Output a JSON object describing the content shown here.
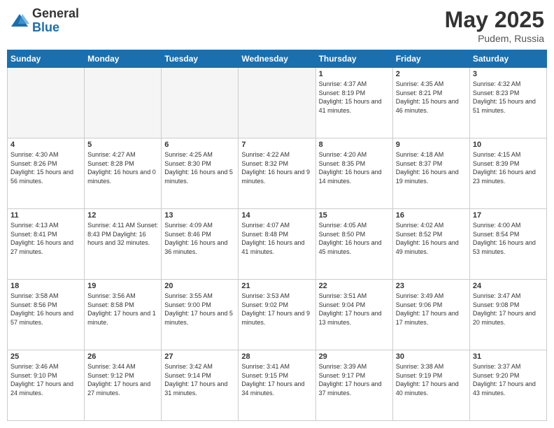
{
  "header": {
    "logo_general": "General",
    "logo_blue": "Blue",
    "title": "May 2025",
    "location": "Pudem, Russia"
  },
  "weekdays": [
    "Sunday",
    "Monday",
    "Tuesday",
    "Wednesday",
    "Thursday",
    "Friday",
    "Saturday"
  ],
  "weeks": [
    [
      {
        "day": "",
        "info": ""
      },
      {
        "day": "",
        "info": ""
      },
      {
        "day": "",
        "info": ""
      },
      {
        "day": "",
        "info": ""
      },
      {
        "day": "1",
        "info": "Sunrise: 4:37 AM\nSunset: 8:19 PM\nDaylight: 15 hours\nand 41 minutes."
      },
      {
        "day": "2",
        "info": "Sunrise: 4:35 AM\nSunset: 8:21 PM\nDaylight: 15 hours\nand 46 minutes."
      },
      {
        "day": "3",
        "info": "Sunrise: 4:32 AM\nSunset: 8:23 PM\nDaylight: 15 hours\nand 51 minutes."
      }
    ],
    [
      {
        "day": "4",
        "info": "Sunrise: 4:30 AM\nSunset: 8:26 PM\nDaylight: 15 hours\nand 56 minutes."
      },
      {
        "day": "5",
        "info": "Sunrise: 4:27 AM\nSunset: 8:28 PM\nDaylight: 16 hours\nand 0 minutes."
      },
      {
        "day": "6",
        "info": "Sunrise: 4:25 AM\nSunset: 8:30 PM\nDaylight: 16 hours\nand 5 minutes."
      },
      {
        "day": "7",
        "info": "Sunrise: 4:22 AM\nSunset: 8:32 PM\nDaylight: 16 hours\nand 9 minutes."
      },
      {
        "day": "8",
        "info": "Sunrise: 4:20 AM\nSunset: 8:35 PM\nDaylight: 16 hours\nand 14 minutes."
      },
      {
        "day": "9",
        "info": "Sunrise: 4:18 AM\nSunset: 8:37 PM\nDaylight: 16 hours\nand 19 minutes."
      },
      {
        "day": "10",
        "info": "Sunrise: 4:15 AM\nSunset: 8:39 PM\nDaylight: 16 hours\nand 23 minutes."
      }
    ],
    [
      {
        "day": "11",
        "info": "Sunrise: 4:13 AM\nSunset: 8:41 PM\nDaylight: 16 hours\nand 27 minutes."
      },
      {
        "day": "12",
        "info": "Sunrise: 4:11 AM\nSunset: 8:43 PM\nDaylight: 16 hours\nand 32 minutes."
      },
      {
        "day": "13",
        "info": "Sunrise: 4:09 AM\nSunset: 8:46 PM\nDaylight: 16 hours\nand 36 minutes."
      },
      {
        "day": "14",
        "info": "Sunrise: 4:07 AM\nSunset: 8:48 PM\nDaylight: 16 hours\nand 41 minutes."
      },
      {
        "day": "15",
        "info": "Sunrise: 4:05 AM\nSunset: 8:50 PM\nDaylight: 16 hours\nand 45 minutes."
      },
      {
        "day": "16",
        "info": "Sunrise: 4:02 AM\nSunset: 8:52 PM\nDaylight: 16 hours\nand 49 minutes."
      },
      {
        "day": "17",
        "info": "Sunrise: 4:00 AM\nSunset: 8:54 PM\nDaylight: 16 hours\nand 53 minutes."
      }
    ],
    [
      {
        "day": "18",
        "info": "Sunrise: 3:58 AM\nSunset: 8:56 PM\nDaylight: 16 hours\nand 57 minutes."
      },
      {
        "day": "19",
        "info": "Sunrise: 3:56 AM\nSunset: 8:58 PM\nDaylight: 17 hours\nand 1 minute."
      },
      {
        "day": "20",
        "info": "Sunrise: 3:55 AM\nSunset: 9:00 PM\nDaylight: 17 hours\nand 5 minutes."
      },
      {
        "day": "21",
        "info": "Sunrise: 3:53 AM\nSunset: 9:02 PM\nDaylight: 17 hours\nand 9 minutes."
      },
      {
        "day": "22",
        "info": "Sunrise: 3:51 AM\nSunset: 9:04 PM\nDaylight: 17 hours\nand 13 minutes."
      },
      {
        "day": "23",
        "info": "Sunrise: 3:49 AM\nSunset: 9:06 PM\nDaylight: 17 hours\nand 17 minutes."
      },
      {
        "day": "24",
        "info": "Sunrise: 3:47 AM\nSunset: 9:08 PM\nDaylight: 17 hours\nand 20 minutes."
      }
    ],
    [
      {
        "day": "25",
        "info": "Sunrise: 3:46 AM\nSunset: 9:10 PM\nDaylight: 17 hours\nand 24 minutes."
      },
      {
        "day": "26",
        "info": "Sunrise: 3:44 AM\nSunset: 9:12 PM\nDaylight: 17 hours\nand 27 minutes."
      },
      {
        "day": "27",
        "info": "Sunrise: 3:42 AM\nSunset: 9:14 PM\nDaylight: 17 hours\nand 31 minutes."
      },
      {
        "day": "28",
        "info": "Sunrise: 3:41 AM\nSunset: 9:15 PM\nDaylight: 17 hours\nand 34 minutes."
      },
      {
        "day": "29",
        "info": "Sunrise: 3:39 AM\nSunset: 9:17 PM\nDaylight: 17 hours\nand 37 minutes."
      },
      {
        "day": "30",
        "info": "Sunrise: 3:38 AM\nSunset: 9:19 PM\nDaylight: 17 hours\nand 40 minutes."
      },
      {
        "day": "31",
        "info": "Sunrise: 3:37 AM\nSunset: 9:20 PM\nDaylight: 17 hours\nand 43 minutes."
      }
    ]
  ]
}
